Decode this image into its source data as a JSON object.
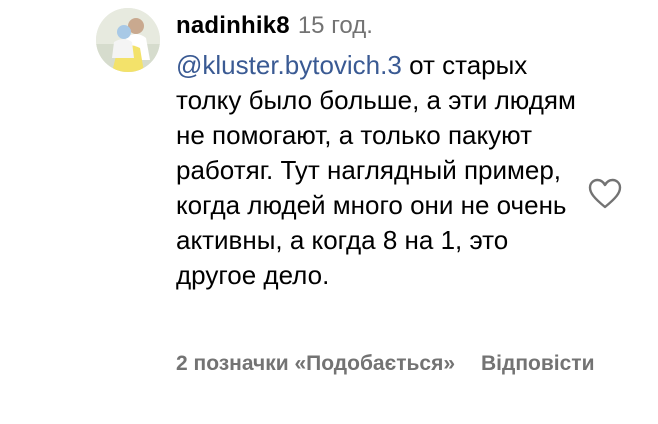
{
  "comment": {
    "username": "nadinhik8",
    "time": "15 год.",
    "mention": "@kluster.bytovich.3",
    "text": "от старых толку было больше, а эти людям не помогают, а только пакуют работяг. Тут наглядный пример, когда людей много они не очень активны, а когда 8 на 1, это другое дело.",
    "likes_label": "2 позначки «Подобається»",
    "reply_label": "Відповісти"
  },
  "icons": {
    "like": "heart-outline-icon",
    "avatar": "user-avatar"
  },
  "colors": {
    "mention": "#3a5a93",
    "muted": "#737373",
    "text": "#000000"
  }
}
